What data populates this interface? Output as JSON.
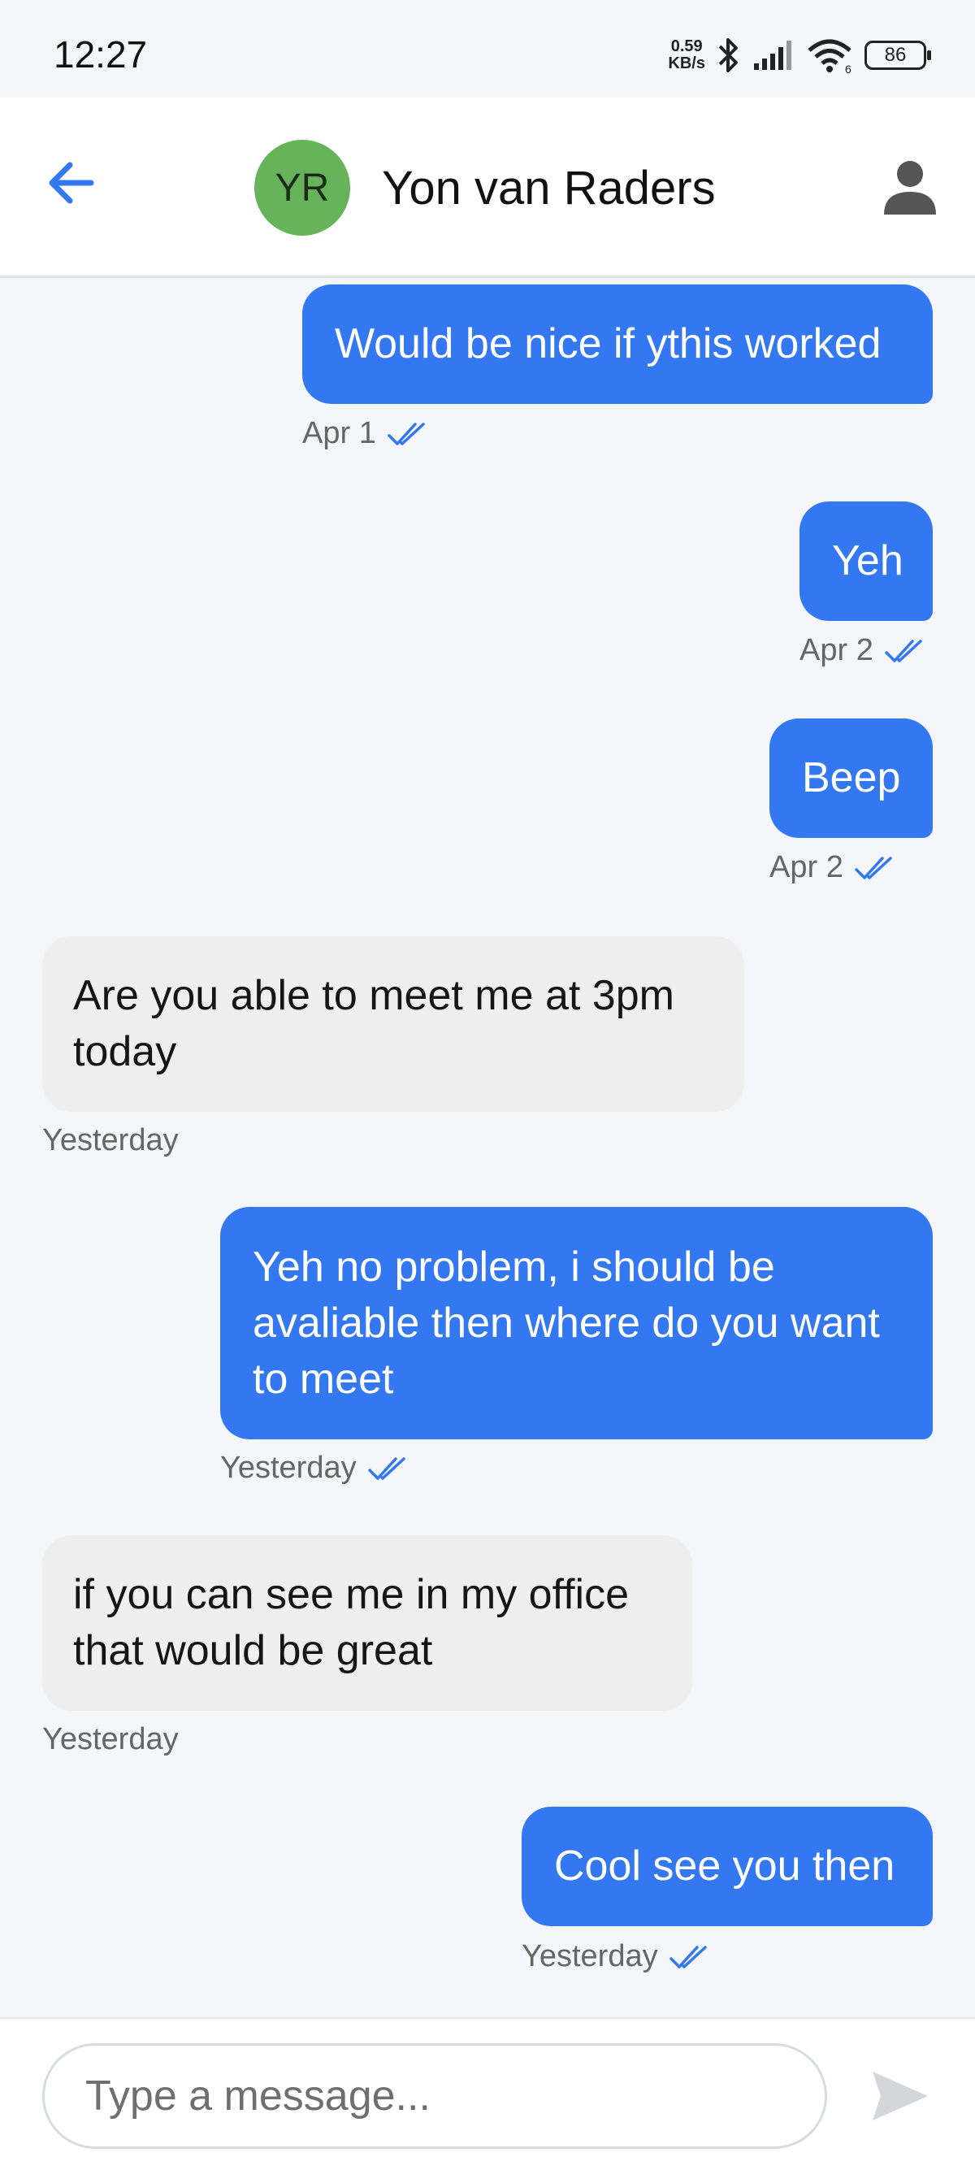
{
  "status_bar": {
    "time": "12:27",
    "net_speed_value": "0.59",
    "net_speed_unit": "KB/s",
    "battery": "86"
  },
  "header": {
    "avatar_initials": "YR",
    "avatar_color": "#66b35a",
    "contact_name": "Yon van Raders"
  },
  "messages": [
    {
      "direction": "out",
      "text": "Would be nice if ythis worked",
      "time": "Apr 1",
      "read": true
    },
    {
      "direction": "out",
      "text": "Yeh",
      "time": "Apr 2",
      "read": true
    },
    {
      "direction": "out",
      "text": "Beep",
      "time": "Apr 2",
      "read": true
    },
    {
      "direction": "in",
      "text": "Are you able to meet me at 3pm today",
      "time": "Yesterday"
    },
    {
      "direction": "out",
      "text": "Yeh no problem, i should be avaliable then where do you want to meet",
      "time": "Yesterday",
      "read": true
    },
    {
      "direction": "in",
      "text": "if you can see me in my office that would be great",
      "time": "Yesterday"
    },
    {
      "direction": "out",
      "text": "Cool see you then",
      "time": "Yesterday",
      "read": true
    }
  ],
  "composer": {
    "placeholder": "Type a message..."
  },
  "colors": {
    "outgoing_bubble": "#3478f1",
    "incoming_bubble": "#efefef",
    "accent": "#3478f1"
  }
}
